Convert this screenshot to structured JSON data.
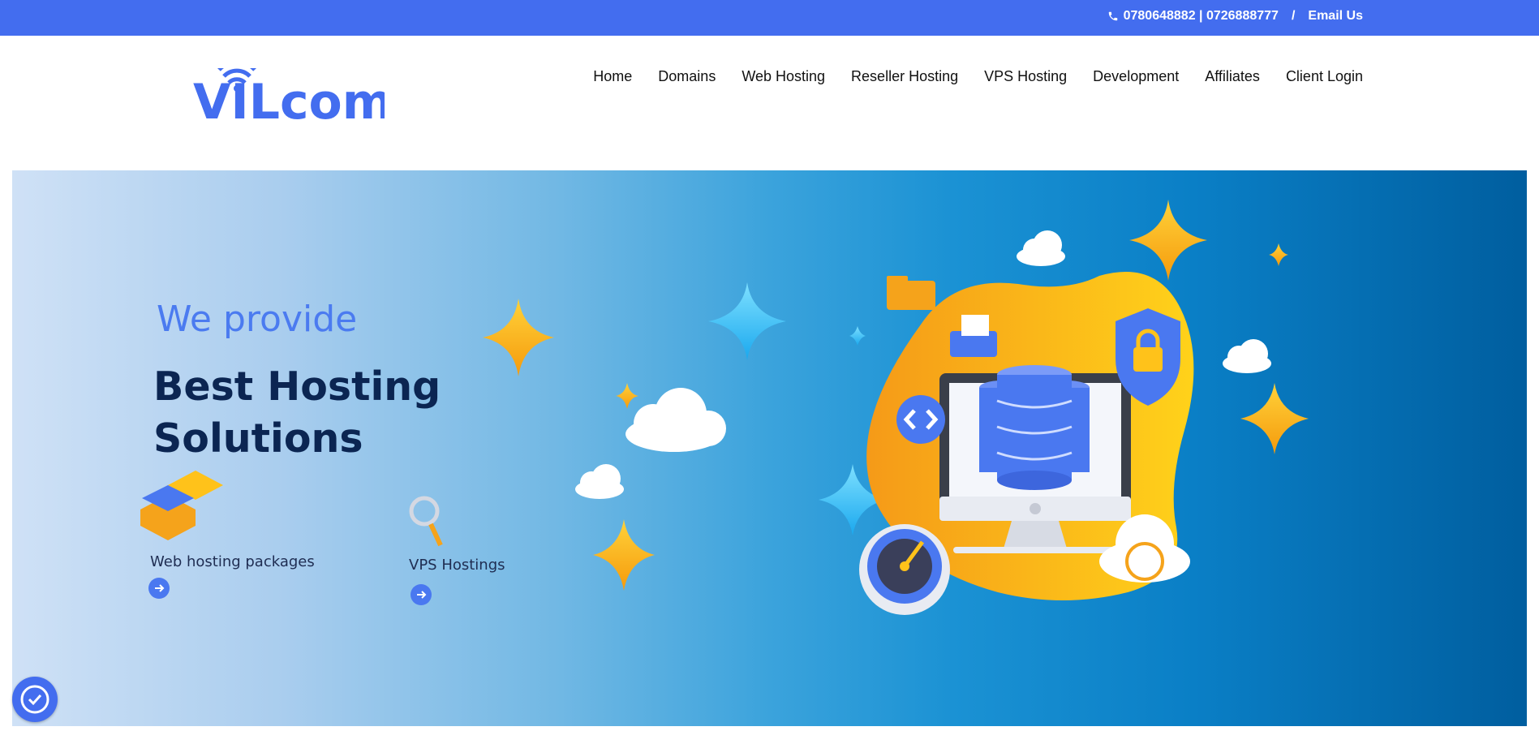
{
  "topbar": {
    "phones": "0780648882 | 0726888777",
    "separator": "/",
    "email_label": "Email Us"
  },
  "logo": {
    "text": "VILcom"
  },
  "nav": {
    "items": [
      {
        "label": "Home"
      },
      {
        "label": "Domains"
      },
      {
        "label": "Web Hosting"
      },
      {
        "label": "Reseller Hosting"
      },
      {
        "label": "VPS Hosting"
      },
      {
        "label": "Development"
      },
      {
        "label": "Affiliates"
      },
      {
        "label": "Client Login"
      }
    ]
  },
  "hero": {
    "subtitle": "We provide",
    "title": "Best Hosting Solutions",
    "features": [
      {
        "label": "Web hosting packages"
      },
      {
        "label": "VPS Hostings"
      }
    ]
  },
  "colors": {
    "brand_blue": "#436def",
    "dark_navy": "#0b2552",
    "accent_orange": "#f7a21b"
  }
}
